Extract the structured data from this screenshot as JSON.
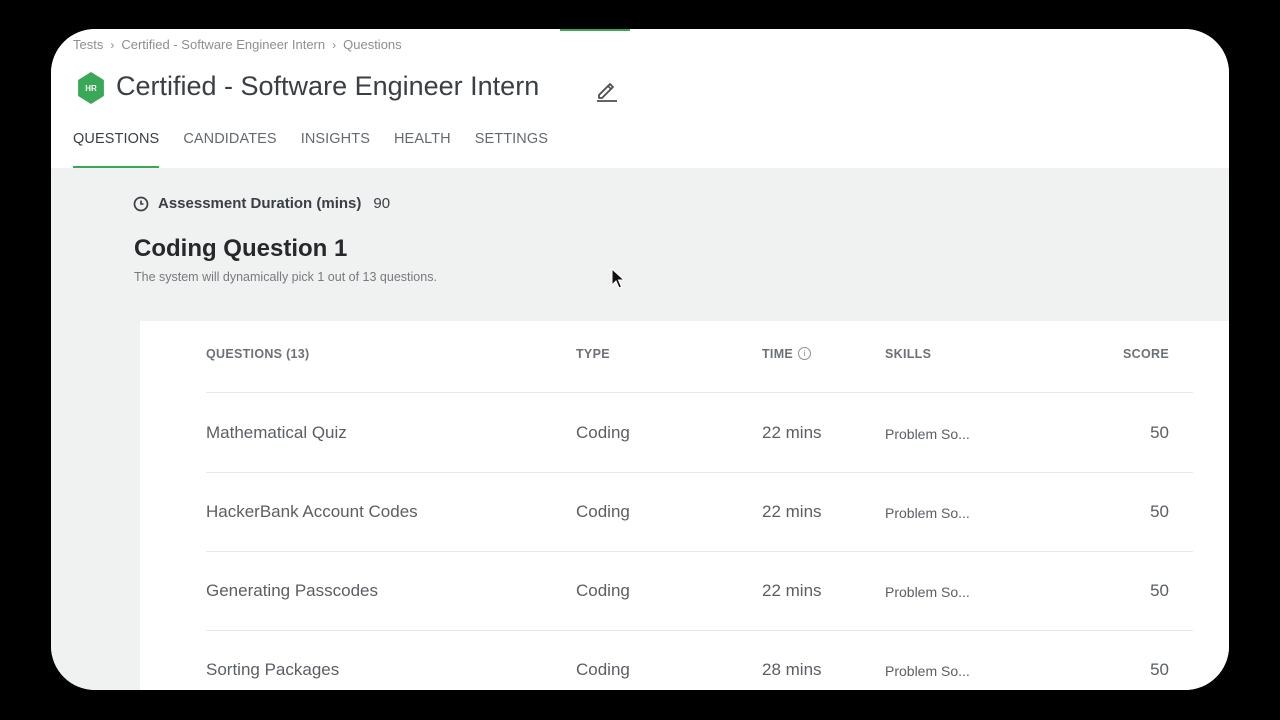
{
  "breadcrumb": [
    "Tests",
    "Certified - Software Engineer Intern",
    "Questions"
  ],
  "logo_text": "HR",
  "page_title": "Certified - Software Engineer Intern",
  "tabs": [
    "QUESTIONS",
    "CANDIDATES",
    "INSIGHTS",
    "HEALTH",
    "SETTINGS"
  ],
  "active_tab": "QUESTIONS",
  "duration": {
    "label": "Assessment Duration (mins)",
    "value": "90"
  },
  "section": {
    "title": "Coding Question 1",
    "subtitle": "The system will dynamically pick 1 out of 13 questions."
  },
  "table": {
    "headers": {
      "questions": "QUESTIONS (13)",
      "type": "TYPE",
      "time": "TIME",
      "skills": "SKILLS",
      "score": "SCORE"
    },
    "rows": [
      {
        "name": "Mathematical Quiz",
        "type": "Coding",
        "time": "22 mins",
        "skills": "Problem So...",
        "score": "50"
      },
      {
        "name": "HackerBank Account Codes",
        "type": "Coding",
        "time": "22 mins",
        "skills": "Problem So...",
        "score": "50"
      },
      {
        "name": "Generating Passcodes",
        "type": "Coding",
        "time": "22 mins",
        "skills": "Problem So...",
        "score": "50"
      },
      {
        "name": "Sorting Packages",
        "type": "Coding",
        "time": "28 mins",
        "skills": "Problem So...",
        "score": "50"
      }
    ]
  },
  "colors": {
    "brand_green": "#39a957",
    "backdrop": "#000000",
    "panel_gray": "#f0f1f1"
  },
  "icons": {
    "edit": "pencil-icon",
    "clock": "clock-icon",
    "time_info": "info-icon",
    "breadcrumb_sep": "chevron-right-icon"
  }
}
